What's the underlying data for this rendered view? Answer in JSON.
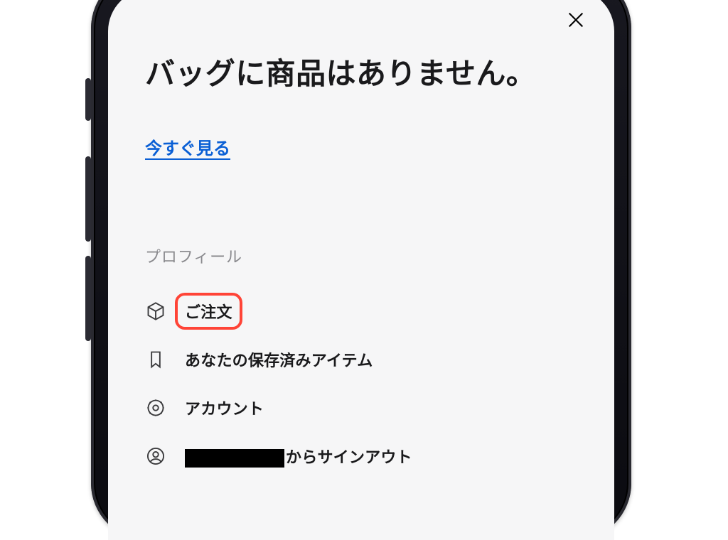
{
  "header": {
    "close_aria": "閉じる"
  },
  "title": "バッグに商品はありません。",
  "primary_link": "今すぐ見る",
  "section_label": "プロフィール",
  "menu": {
    "orders": {
      "label": "ご注文"
    },
    "saved": {
      "label": "あなたの保存済みアイテム"
    },
    "account": {
      "label": "アカウント"
    },
    "signout": {
      "suffix": "からサインアウト"
    }
  },
  "highlight_target": "orders",
  "colors": {
    "link": "#0a5fd5",
    "highlight": "#ff4437",
    "muted": "#8a8a8e"
  }
}
